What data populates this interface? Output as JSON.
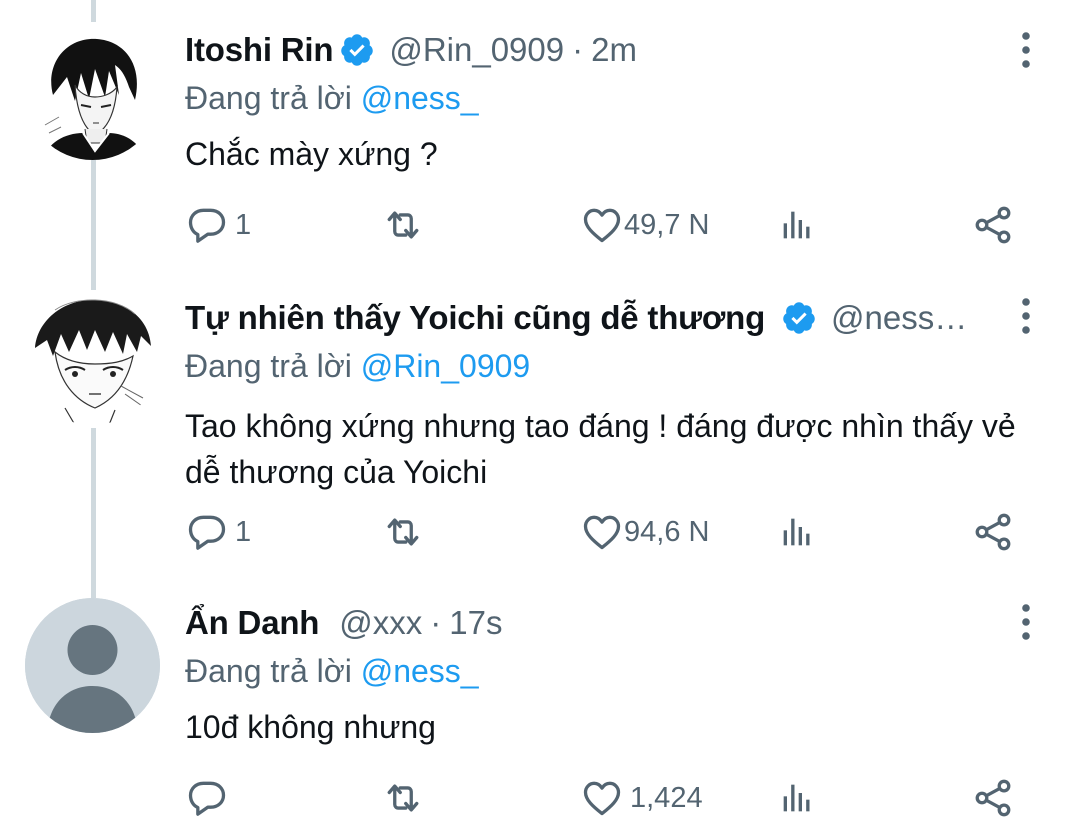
{
  "tweets": [
    {
      "display_name": "Itoshi Rin",
      "verified": true,
      "handle": "@Rin_0909",
      "separator": "·",
      "time": "2m",
      "reply_prefix": "Đang trả lời",
      "reply_to": "@ness_",
      "text": "Chắc mày xứng ?",
      "replies": "1",
      "likes": "49,7 N",
      "avatar": "manga-boy-avatar"
    },
    {
      "display_name": "Tự nhiên thấy Yoichi cũng dễ thương",
      "verified": true,
      "handle": "@ness…",
      "separator": "",
      "time": "",
      "reply_prefix": "Đang trả lời",
      "reply_to": "@Rin_0909",
      "text": "Tao không xứng nhưng tao đáng ! đáng được nhìn thấy vẻ dễ thương của Yoichi",
      "replies": "1",
      "likes": "94,6 N",
      "avatar": "manga-sketch-avatar"
    },
    {
      "display_name": "Ẩn Danh",
      "verified": false,
      "handle": "@xxx",
      "separator": "·",
      "time": "17s",
      "reply_prefix": "Đang trả lời",
      "reply_to": "@ness_",
      "text": "10đ không nhưng",
      "replies": "",
      "likes": "1,424",
      "avatar": "default-user-avatar"
    }
  ],
  "colors": {
    "text_primary": "#0f1419",
    "text_secondary": "#536471",
    "accent": "#1d9bf0",
    "thread_line": "#cfd9de",
    "default_avatar_bg": "#ccd6dd",
    "default_avatar_fg": "#66757f"
  },
  "icons": [
    "reply-icon",
    "retweet-icon",
    "like-icon",
    "analytics-icon",
    "share-icon",
    "more-icon",
    "verified-icon"
  ]
}
